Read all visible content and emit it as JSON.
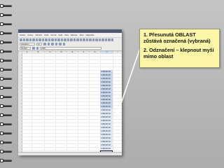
{
  "callout": {
    "item1": "1. Přesunutá OBLAST zůstává označená (vybraná)",
    "item2": "2. Odznačení – klepnout myší mimo oblast"
  },
  "spreadsheet": {
    "menu": [
      "Soubor",
      "Úpravy",
      "Zobrazit",
      "Vložit",
      "Formát",
      "Sešit",
      "Data",
      "Nástroje",
      "Okno",
      "Nápověda"
    ],
    "font_name": "Liberation Sans",
    "font_size": "10",
    "cell_ref": "H1:H24",
    "formula": "1000",
    "columns": [
      "A",
      "B",
      "C",
      "D",
      "E",
      "F",
      "G",
      "H",
      "I"
    ],
    "selected_value": "1 000,00 Kč"
  },
  "colors": {
    "callout_fill": "#fbf6a8",
    "arrow": "#ffffff",
    "selection": "#c9d7ee"
  }
}
